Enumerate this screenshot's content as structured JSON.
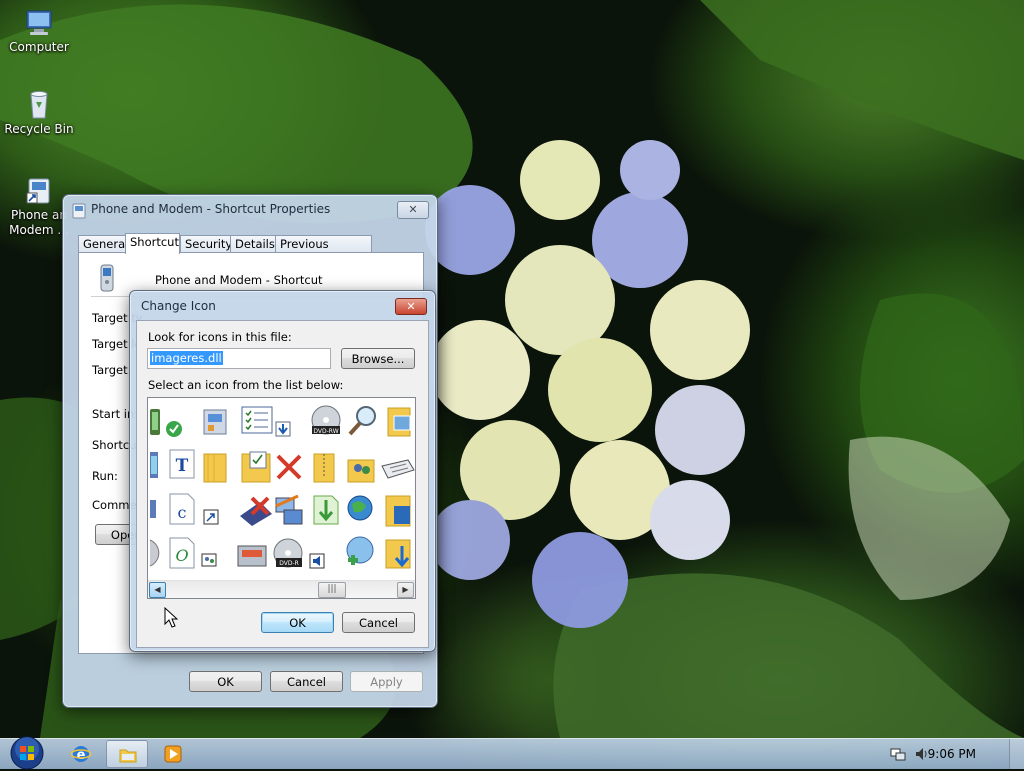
{
  "desktop": {
    "icons": [
      {
        "label": "Computer",
        "icon": "computer-icon"
      },
      {
        "label": "Recycle Bin",
        "icon": "recycle-bin-icon"
      },
      {
        "label_line1": "Phone an",
        "label_line2": "Modem ...",
        "icon": "shortcut-icon"
      }
    ]
  },
  "properties_window": {
    "title": "Phone and Modem - Shortcut Properties",
    "close_symbol": "✕",
    "tabs": [
      "General",
      "Shortcut",
      "Security",
      "Details",
      "Previous Versions"
    ],
    "active_tab": "Shortcut",
    "shortcut_name": "Phone and Modem - Shortcut",
    "fields": {
      "target_type": "Target ty",
      "target_location": "Target lo",
      "target": "Target:",
      "start_in": "Start in:",
      "shortcut_key": "Shortcut",
      "run": "Run:",
      "comment": "Commen"
    },
    "open_button": "Oper",
    "ok_button": "OK",
    "cancel_button": "Cancel",
    "apply_button": "Apply"
  },
  "change_icon_dialog": {
    "title": "Change Icon",
    "close_symbol": "✕",
    "look_for_label": "Look for icons in this file:",
    "file_value": "imageres.dll",
    "browse_button": "Browse...",
    "select_label": "Select an icon from the list below:",
    "icons": [
      "phone-icon",
      "check-icon",
      "control-panel-icon",
      "checklist-icon",
      "download-icon",
      "dvd-rw-icon",
      "search-icon",
      "folder-picture-icon",
      "tablet-icon",
      "text-icon",
      "folder-icon",
      "folder-check-icon",
      "red-x-icon",
      "folder-zip-icon",
      "users-icon",
      "keyboard-icon",
      "pen-icon",
      "text-doc-icon",
      "shortcut-arrow-icon",
      "disk-remove-icon",
      "network-icon",
      "download-doc-icon",
      "globe-icon",
      "folder-blue-icon",
      "disc-icon",
      "o-doc-icon",
      "users-doc-icon",
      "scanner-icon",
      "dvd-r-icon",
      "speaker-icon",
      "globe-add-icon",
      "folder-down-icon"
    ],
    "scroll_thumb": "|||",
    "ok_button": "OK",
    "cancel_button": "Cancel"
  },
  "taskbar": {
    "items": [
      "start-orb-icon",
      "internet-explorer-icon",
      "windows-explorer-icon",
      "media-player-icon"
    ],
    "clock": "9:06 PM"
  }
}
